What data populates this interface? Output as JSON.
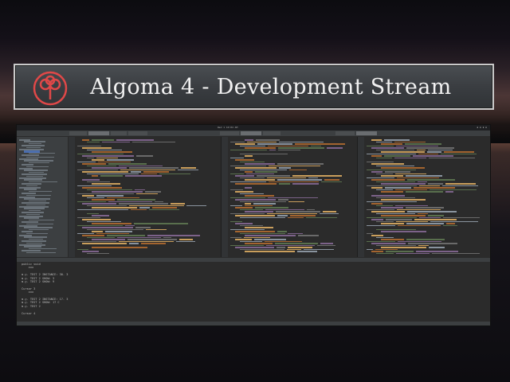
{
  "banner": {
    "title": "Algoma 4 - Development Stream",
    "logo": "tree-logo-icon",
    "accent": "#e04848"
  },
  "ide": {
    "clock": "Wed 1 10:04 AM",
    "console_lines": [
      "public void",
      "    xxx",
      "",
      "m.y. TEST 2 INSTANCE: 30. 3",
      "m.y. TEST 2 SHOW: 3",
      "m.y. TEST 2 SHOW: 9",
      "",
      "Cursor 3",
      "    xxx",
      "",
      "m.y. TEST 2 INSTANCE: 17. 3",
      "m.y. TEST 2 SHOW: 17 C",
      "m.y. TEST 2",
      "",
      "Cursor 4"
    ]
  }
}
